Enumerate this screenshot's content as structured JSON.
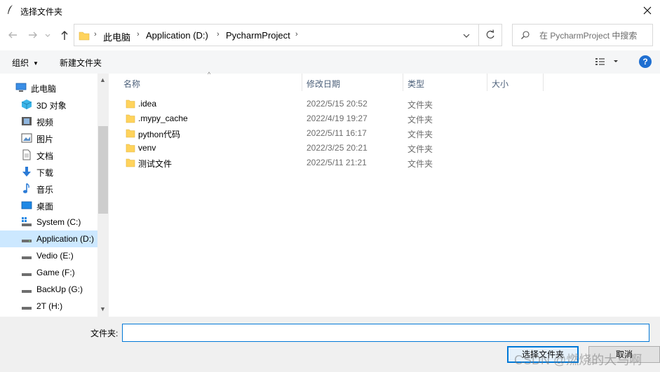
{
  "window": {
    "title": "选择文件夹"
  },
  "navigation": {
    "breadcrumbs": [
      "此电脑",
      "Application (D:)",
      "PycharmProject"
    ],
    "search_placeholder": "在 PycharmProject 中搜索"
  },
  "toolbar": {
    "organize_label": "组织",
    "new_folder_label": "新建文件夹"
  },
  "sidebar": {
    "items": [
      {
        "label": "此电脑",
        "icon": "computer-icon"
      },
      {
        "label": "3D 对象",
        "icon": "cube-icon"
      },
      {
        "label": "视频",
        "icon": "video-icon"
      },
      {
        "label": "图片",
        "icon": "picture-icon"
      },
      {
        "label": "文档",
        "icon": "document-icon"
      },
      {
        "label": "下载",
        "icon": "download-icon"
      },
      {
        "label": "音乐",
        "icon": "music-icon"
      },
      {
        "label": "桌面",
        "icon": "desktop-icon"
      },
      {
        "label": "System (C:)",
        "icon": "system-drive-icon"
      },
      {
        "label": "Application (D:)",
        "icon": "drive-icon",
        "selected": true
      },
      {
        "label": "Vedio (E:)",
        "icon": "drive-icon"
      },
      {
        "label": "Game (F:)",
        "icon": "drive-icon"
      },
      {
        "label": "BackUp (G:)",
        "icon": "drive-icon"
      },
      {
        "label": "2T (H:)",
        "icon": "drive-icon"
      }
    ]
  },
  "columns": {
    "name": "名称",
    "date": "修改日期",
    "type": "类型",
    "size": "大小"
  },
  "files": [
    {
      "name": ".idea",
      "date": "2022/5/15 20:52",
      "type": "文件夹"
    },
    {
      "name": ".mypy_cache",
      "date": "2022/4/19 19:27",
      "type": "文件夹"
    },
    {
      "name": "python代码",
      "date": "2022/5/11 16:17",
      "type": "文件夹"
    },
    {
      "name": "venv",
      "date": "2022/3/25 20:21",
      "type": "文件夹"
    },
    {
      "name": "测试文件",
      "date": "2022/5/11 21:21",
      "type": "文件夹"
    }
  ],
  "footer": {
    "folder_label": "文件夹:",
    "folder_value": "",
    "select_button": "选择文件夹",
    "cancel_button": "取消"
  },
  "watermark": "CSDN @燃烧的大鸟啊",
  "colors": {
    "accent": "#0078d7",
    "selected_bg": "#cce8ff",
    "folder": "#ffd35c",
    "help": "#1f6fd1"
  }
}
